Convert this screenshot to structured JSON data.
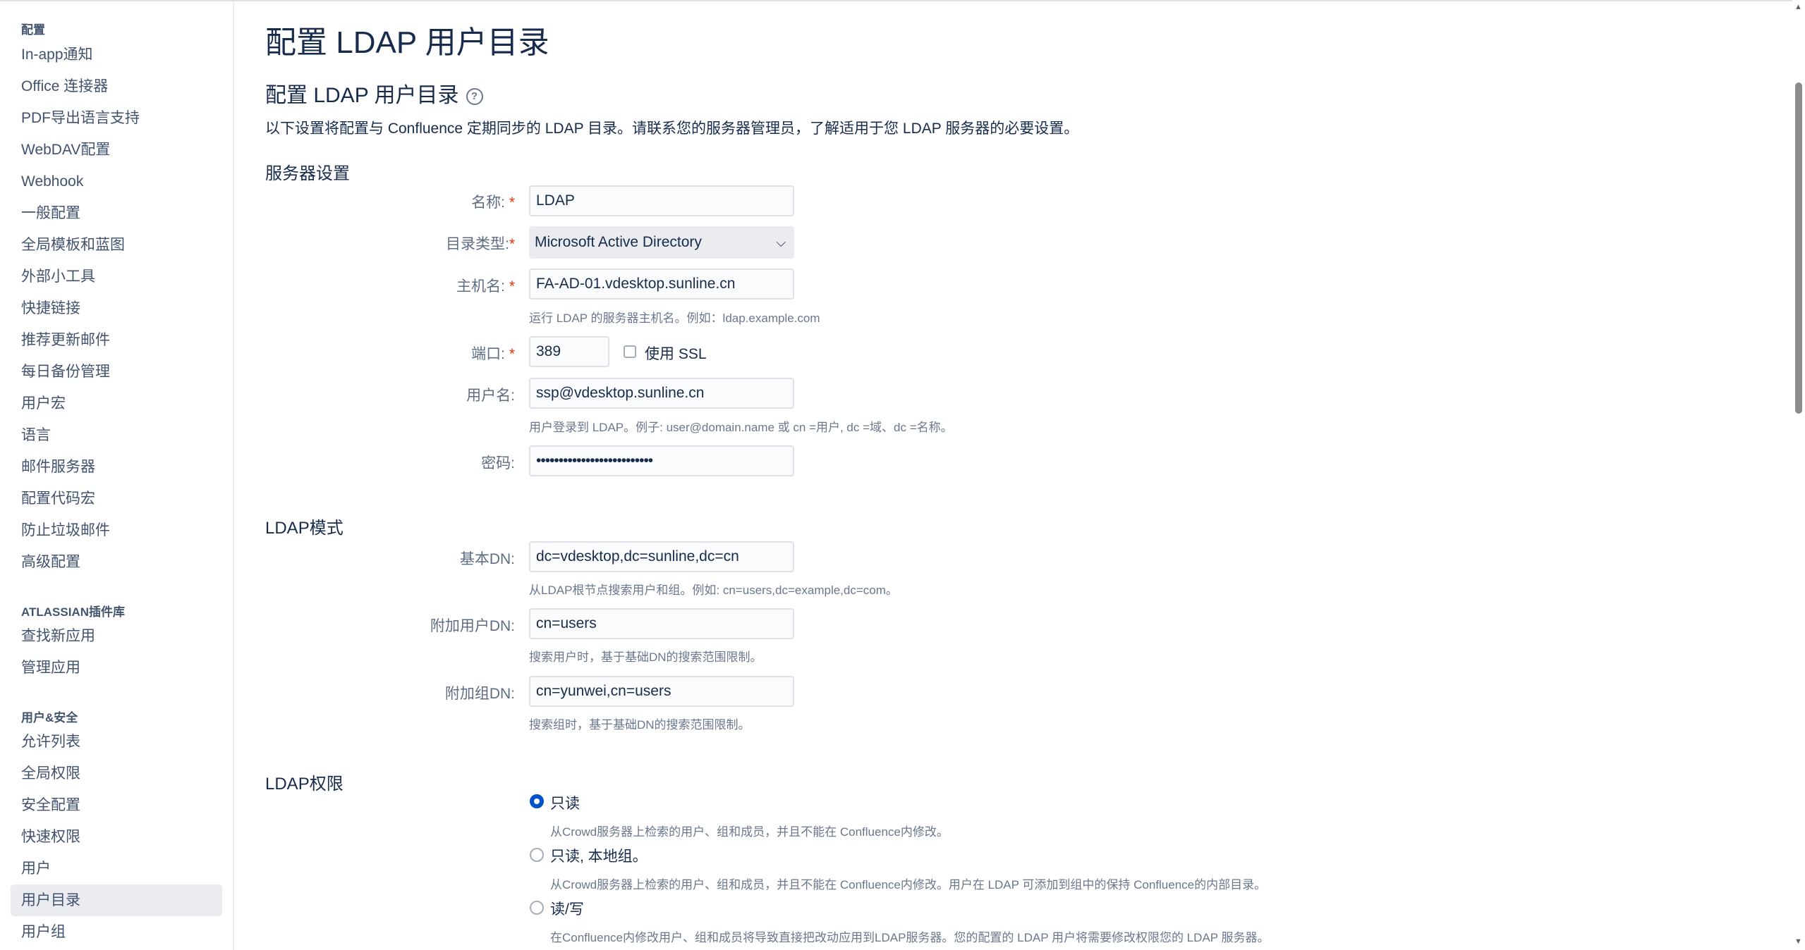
{
  "sidebar": {
    "section1": "配置",
    "items1": [
      "In-app通知",
      "Office 连接器",
      "PDF导出语言支持",
      "WebDAV配置",
      "Webhook",
      "一般配置",
      "全局模板和蓝图",
      "外部小工具",
      "快捷链接",
      "推荐更新邮件",
      "每日备份管理",
      "用户宏",
      "语言",
      "邮件服务器",
      "配置代码宏",
      "防止垃圾邮件",
      "高级配置"
    ],
    "section2": "ATLASSIAN插件库",
    "items2": [
      "查找新应用",
      "管理应用"
    ],
    "section3": "用户&安全",
    "items3": [
      "允许列表",
      "全局权限",
      "安全配置",
      "快速权限",
      "用户",
      "用户目录",
      "用户组"
    ],
    "active_item": "用户目录"
  },
  "page": {
    "title": "配置 LDAP 用户目录",
    "subtitle": "配置 LDAP 用户目录",
    "help_icon": "question-circle-icon",
    "intro": "以下设置将配置与 Confluence 定期同步的 LDAP 目录。请联系您的服务器管理员，了解适用于您 LDAP 服务器的必要设置。"
  },
  "server": {
    "heading": "服务器设置",
    "name_label": "名称:",
    "name_value": "LDAP",
    "type_label": "目录类型:",
    "type_value": "Microsoft Active Directory",
    "host_label": "主机名:",
    "host_value": "FA-AD-01.vdesktop.sunline.cn",
    "host_hint": "运行 LDAP 的服务器主机名。例如：ldap.example.com",
    "port_label": "端口:",
    "port_value": "389",
    "ssl_label": "使用 SSL",
    "ssl_checked": false,
    "user_label": "用户名:",
    "user_value": "ssp@vdesktop.sunline.cn",
    "user_hint": "用户登录到 LDAP。例子: user@domain.name 或 cn =用户, dc =域、dc =名称。",
    "password_label": "密码:",
    "password_value": "••••••••••••••••••••••••••"
  },
  "schema": {
    "heading": "LDAP模式",
    "base_dn_label": "基本DN:",
    "base_dn_value": "dc=vdesktop,dc=sunline,dc=cn",
    "base_dn_hint": "从LDAP根节点搜索用户和组。例如: cn=users,dc=example,dc=com。",
    "user_dn_label": "附加用户DN:",
    "user_dn_value": "cn=users",
    "user_dn_hint": "搜索用户时，基于基础DN的搜索范围限制。",
    "group_dn_label": "附加组DN:",
    "group_dn_value": "cn=yunwei,cn=users",
    "group_dn_hint": "搜索组时，基于基础DN的搜索范围限制。"
  },
  "permissions": {
    "heading": "LDAP权限",
    "options": [
      {
        "label": "只读",
        "desc": "从Crowd服务器上检索的用户、组和成员，并且不能在 Confluence内修改。",
        "selected": true
      },
      {
        "label": "只读, 本地组。",
        "desc": "从Crowd服务器上检索的用户、组和成员，并且不能在 Confluence内修改。用户在 LDAP 可添加到组中的保持 Confluence的内部目录。",
        "selected": false
      },
      {
        "label": "读/写",
        "desc": "在Confluence内修改用户、组和成员将导致直接把改动应用到LDAP服务器。您的配置的 LDAP 用户将需要修改权限您的 LDAP 服务器。",
        "selected": false
      }
    ]
  }
}
